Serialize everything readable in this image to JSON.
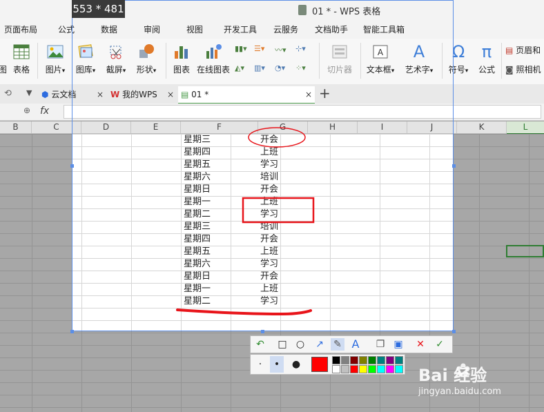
{
  "app": {
    "title": "01 * - WPS 表格",
    "capture_size": "553 * 481"
  },
  "menu": [
    "页面布局",
    "公式",
    "数据",
    "审阅",
    "视图",
    "开发工具",
    "云服务",
    "文档助手",
    "智能工具箱"
  ],
  "ribbon": {
    "left_partial": "图",
    "table": "表格",
    "picture": "图片",
    "gallery": "图库",
    "screenshot": "截屏",
    "shape": "形状",
    "chart": "图表",
    "online_chart": "在线图表",
    "clip": "切片器",
    "textbox": "文本框",
    "wordart": "艺术字",
    "symbol": "符号",
    "formula": "公式",
    "header_footer": "页眉和",
    "camera": "照相机",
    "dropdown_marker": "▾"
  },
  "tabs": [
    {
      "label": "云文档"
    },
    {
      "label": "我的WPS"
    },
    {
      "label": "01 *"
    }
  ],
  "tab_add": "+",
  "tab_close": "×",
  "formula_bar": {
    "fx": "fx",
    "value": ""
  },
  "columns": [
    "B",
    "C",
    "D",
    "E",
    "F",
    "G",
    "H",
    "I",
    "J",
    "K",
    "L"
  ],
  "rows": [
    {
      "day": "星期三",
      "task": "开会"
    },
    {
      "day": "星期四",
      "task": "上班"
    },
    {
      "day": "星期五",
      "task": "学习"
    },
    {
      "day": "星期六",
      "task": "培训"
    },
    {
      "day": "星期日",
      "task": "开会"
    },
    {
      "day": "星期一",
      "task": "上班"
    },
    {
      "day": "星期二",
      "task": "学习"
    },
    {
      "day": "星期三",
      "task": "培训"
    },
    {
      "day": "星期四",
      "task": "开会"
    },
    {
      "day": "星期五",
      "task": "上班"
    },
    {
      "day": "星期六",
      "task": "学习"
    },
    {
      "day": "星期日",
      "task": "开会"
    },
    {
      "day": "星期一",
      "task": "上班"
    },
    {
      "day": "星期二",
      "task": "学习"
    }
  ],
  "annotation": {
    "text_tool": "A",
    "dots": [
      "·",
      "•",
      "●"
    ],
    "selected_color": "#ff0000",
    "palette": [
      "#000000",
      "#808080",
      "#800000",
      "#808000",
      "#008000",
      "#008080",
      "#800080",
      "#008080",
      "#ffffff",
      "#c0c0c0",
      "#ff0000",
      "#ffff00",
      "#00ff00",
      "#00ffff",
      "#ff00ff",
      "#00ffff"
    ]
  },
  "watermark": {
    "brand": "Bai 经验",
    "url": "jingyan.baidu.com"
  },
  "colors": {
    "annotation_red": "#e8141a",
    "selection_blue": "#5b8ee6",
    "active_cell": "#2e7d32"
  }
}
